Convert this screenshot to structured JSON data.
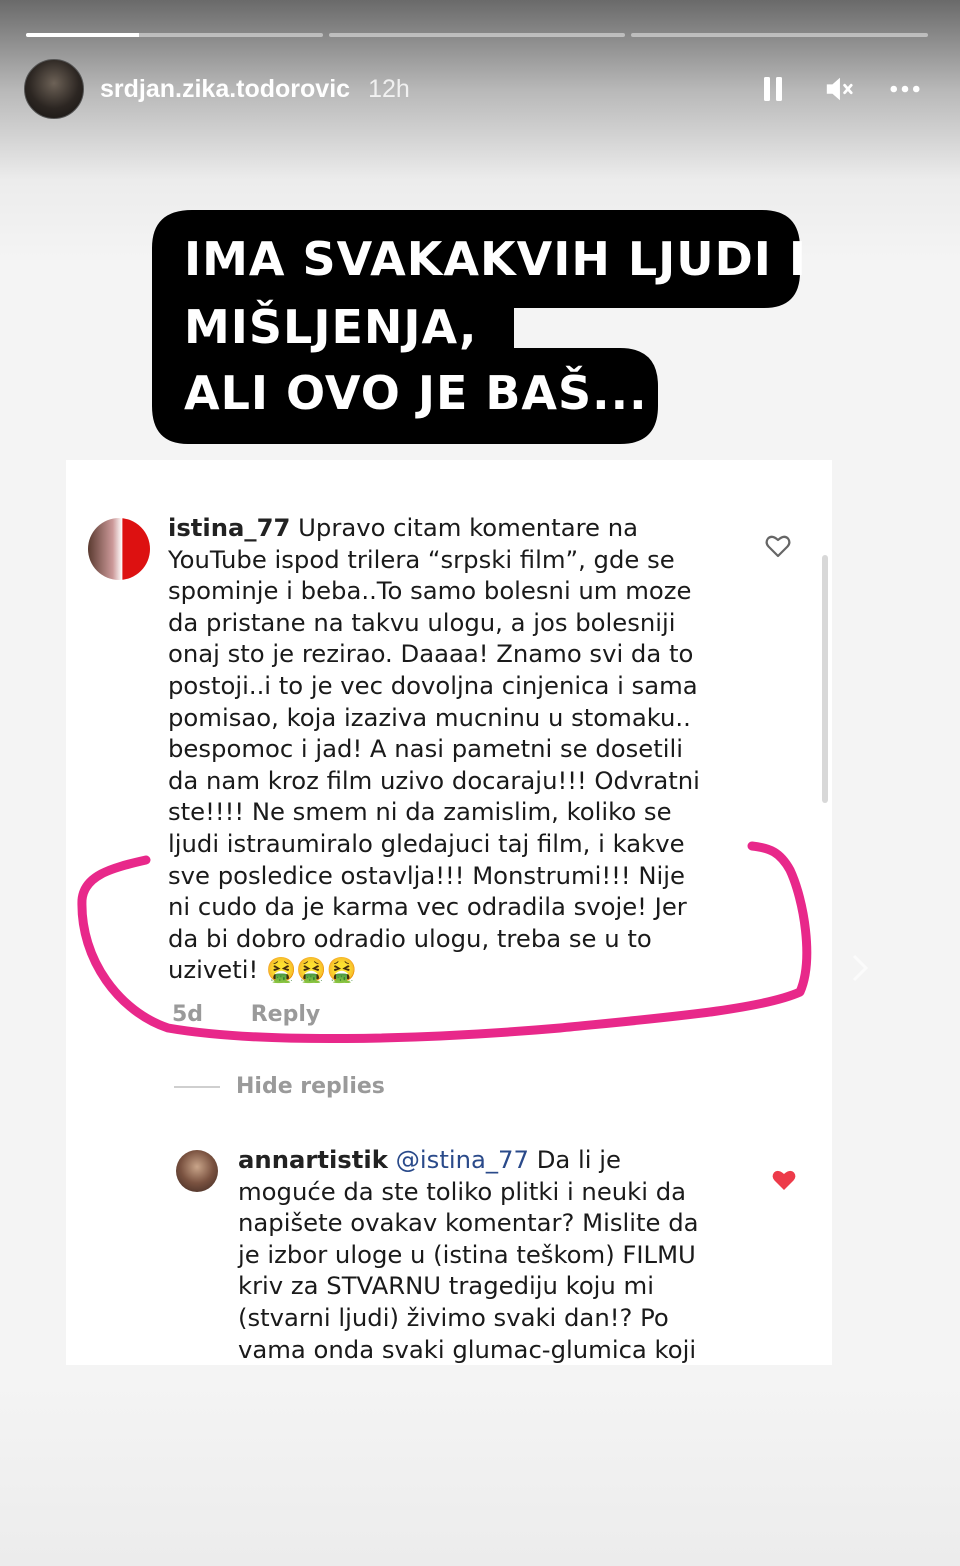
{
  "story": {
    "progress": [
      1,
      0,
      0
    ],
    "username": "srdjan.zika.todorovic",
    "time": "12h",
    "controls": {
      "pause": "pause-icon",
      "mute": "mute-icon",
      "more": "more-icon"
    }
  },
  "callout": {
    "lines": [
      "IMA SVAKAKVIH LJUDI I",
      "MIŠLJENJA,",
      "ALI OVO JE BAŠ..."
    ]
  },
  "comment1": {
    "username": "istina_77",
    "lines": [
      "Upravo citam komentare na",
      "YouTube ispod trilera “srpski film”, gde se",
      "spominje i beba..To samo bolesni um moze",
      "da pristane na takvu ulogu, a jos bolesniji",
      "onaj sto je rezirao. Daaaa! Znamo svi da to",
      "postoji..i to je vec dovoljna cinjenica i sama",
      "pomisao, koja izaziva mucninu u stomaku..",
      "bespomoc i jad! A nasi pametni se dosetili",
      "da nam kroz film uzivo docaraju!!! Odvratni",
      "ste!!!! Ne smem ni da zamislim, koliko  se",
      "ljudi istraumiralo gledajuci taj film, i kakve",
      "sve posledice ostavlja!!! Monstrumi!!! Nije",
      "ni cudo da je karma vec odradila svoje! Jer",
      "da bi dobro odradio ulogu, treba se u to",
      "uziveti! 🤮🤮🤮"
    ],
    "age": "5d",
    "reply": "Reply",
    "liked": false
  },
  "hide_replies": "Hide replies",
  "comment2": {
    "username": "annartistik",
    "mention": "@istina_77",
    "first_tail": "Da li je",
    "lines": [
      "moguće da ste toliko plitki i neuki da",
      "napišete ovakav komentar? Mislite da",
      "je izbor uloge u (istina teškom) FILMU",
      "kriv za STVARNU tragediju koju mi",
      "(stvarni ljudi) živimo svaki dan!? Po",
      "vama onda svaki glumac-glumica koji"
    ],
    "liked": true
  },
  "colors": {
    "highlight": "#e8288a",
    "heart_liked": "#ed3b4a",
    "callout_bg": "#000000"
  }
}
